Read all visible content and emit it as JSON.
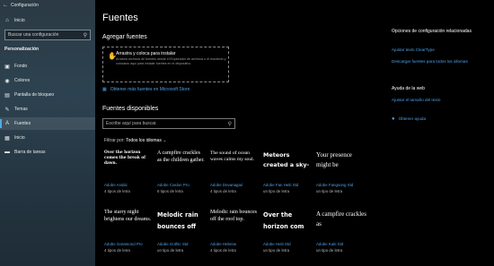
{
  "window": {
    "title": "Configuración"
  },
  "sidebar": {
    "home": "Inicio",
    "search_placeholder": "Buscar una configuración",
    "section": "Personalización",
    "items": [
      {
        "label": "Fondo",
        "icon": "image-icon"
      },
      {
        "label": "Colores",
        "icon": "palette-icon"
      },
      {
        "label": "Pantalla de bloqueo",
        "icon": "lock-screen-icon"
      },
      {
        "label": "Temas",
        "icon": "brush-icon"
      },
      {
        "label": "Fuentes",
        "icon": "font-icon",
        "selected": true
      },
      {
        "label": "Inicio",
        "icon": "start-icon"
      },
      {
        "label": "Barra de tareas",
        "icon": "taskbar-icon"
      }
    ]
  },
  "main": {
    "title": "Fuentes",
    "add_heading": "Agregar fuentes",
    "drop_title": "Arrastra y coloca para instalar",
    "drop_desc": "Arrastra archivos de fuentes desde el Explorador de archivos o el escritorio y colócalos aquí para instalar fuentes en el dispositivo.",
    "store_link": "Obtener más fuentes en Microsoft Store",
    "available_heading": "Fuentes disponibles",
    "search_placeholder": "Escribe aquí para buscar.",
    "filter_label": "Filtrar por:",
    "filter_value": "Todos los idiomas",
    "fonts": [
      {
        "sample": "Over the horizon comes the break of dawn.",
        "name": "Adobe Arabic",
        "count": "4 tipos de letra"
      },
      {
        "sample": "A campfire crackles as the children gather.",
        "name": "Adobe Caslon Pro",
        "count": "6 tipos de letra"
      },
      {
        "sample": "The sound of ocean waves calms my soul.",
        "name": "Adobe Devanagari",
        "count": "4 tipos de letra"
      },
      {
        "sample": "Meteors created a sky-",
        "name": "Adobe Fan Heiti Std",
        "count": "un tipo de letra"
      },
      {
        "sample": "Your presence might be",
        "name": "Adobe Fangsong Std",
        "count": "un tipo de letra"
      },
      {
        "sample": "The starry night brightens our dreams.",
        "name": "Adobe Garamond Pro",
        "count": "4 tipos de letra"
      },
      {
        "sample": "Melodic rain bounces off",
        "name": "Adobe Gothic Std",
        "count": "un tipo de letra"
      },
      {
        "sample": "Melodic rain bounces off the roof top.",
        "name": "Adobe Hebrew",
        "count": "4 tipos de letra"
      },
      {
        "sample": "Over the horizon com",
        "name": "Adobe Heiti Std",
        "count": "un tipo de letra"
      },
      {
        "sample": "A campfire crackles as",
        "name": "Adobe Kaiti Std",
        "count": "un tipo de letra"
      }
    ]
  },
  "related": {
    "title": "Opciones de configuración relacionadas",
    "links": [
      "Ajustar texto ClearType",
      "Descargar fuentes para todos los idiomas"
    ],
    "help_heading": "Ayuda de la web",
    "help_link": "Ajustar el tamaño del texto",
    "get_help": "Obtener ayuda"
  }
}
